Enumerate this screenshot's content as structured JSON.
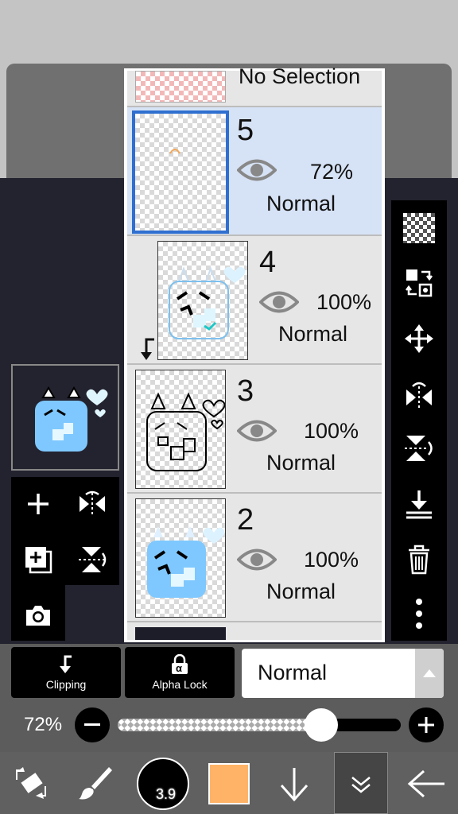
{
  "layers_panel": {
    "top_row": {
      "label": "No Selection"
    },
    "layers": [
      {
        "number": "5",
        "opacity": "72%",
        "blend": "Normal",
        "selected": true
      },
      {
        "number": "4",
        "opacity": "100%",
        "blend": "Normal",
        "clipped": true
      },
      {
        "number": "3",
        "opacity": "100%",
        "blend": "Normal"
      },
      {
        "number": "2",
        "opacity": "100%",
        "blend": "Normal"
      }
    ]
  },
  "layer_options": {
    "clipping_label": "Clipping",
    "alpha_lock_label": "Alpha Lock",
    "alpha_symbol": "α",
    "blend_mode": "Normal"
  },
  "opacity": {
    "value_label": "72%",
    "value": 0.72
  },
  "bottom_toolbar": {
    "brush_size": "3.9",
    "color": "#ffb366"
  },
  "colors": {
    "selected_row": "#d6e2f5",
    "selected_border": "#2f6fd0",
    "canvas_bg": "#23232f"
  }
}
